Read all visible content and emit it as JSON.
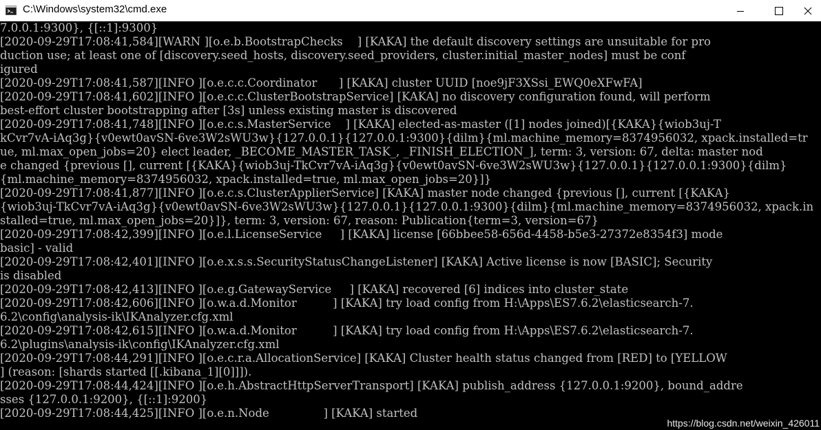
{
  "window": {
    "title": "C:\\Windows\\system32\\cmd.exe",
    "icon": "cmd-icon",
    "buttons": [
      "minimize-icon",
      "maximize-icon",
      "close-icon"
    ]
  },
  "colors": {
    "console_bg": "#000000",
    "console_text": "#c0c0c0",
    "titlebar_bg": "#ffffff"
  },
  "console": {
    "lines": [
      "7.0.0.1:9300}, {[::1]:9300}",
      "[2020-09-29T17:08:41,584][WARN ][o.e.b.BootstrapChecks    ] [KAKA] the default discovery settings are unsuitable for pro",
      "duction use; at least one of [discovery.seed_hosts, discovery.seed_providers, cluster.initial_master_nodes] must be conf",
      "igured",
      "[2020-09-29T17:08:41,587][INFO ][o.e.c.c.Coordinator      ] [KAKA] cluster UUID [noe9jF3XSsi_EWQ0eXFwFA]",
      "[2020-09-29T17:08:41,602][INFO ][o.e.c.c.ClusterBootstrapService] [KAKA] no discovery configuration found, will perform",
      "best-effort cluster bootstrapping after [3s] unless existing master is discovered",
      "[2020-09-29T17:08:41,748][INFO ][o.e.c.s.MasterService    ] [KAKA] elected-as-master ([1] nodes joined)[{KAKA}{wiob3uj-T",
      "kCvr7vA-iAq3g}{v0ewt0avSN-6ve3W2sWU3w}{127.0.0.1}{127.0.0.1:9300}{dilm}{ml.machine_memory=8374956032, xpack.installed=tr",
      "ue, ml.max_open_jobs=20} elect leader, _BECOME_MASTER_TASK_, _FINISH_ELECTION_], term: 3, version: 67, delta: master nod",
      "e changed {previous [], current [{KAKA}{wiob3uj-TkCvr7vA-iAq3g}{v0ewt0avSN-6ve3W2sWU3w}{127.0.0.1}{127.0.0.1:9300}{dilm}",
      "{ml.machine_memory=8374956032, xpack.installed=true, ml.max_open_jobs=20}]}",
      "[2020-09-29T17:08:41,877][INFO ][o.e.c.s.ClusterApplierService] [KAKA] master node changed {previous [], current [{KAKA}",
      "{wiob3uj-TkCvr7vA-iAq3g}{v0ewt0avSN-6ve3W2sWU3w}{127.0.0.1}{127.0.0.1:9300}{dilm}{ml.machine_memory=8374956032, xpack.in",
      "stalled=true, ml.max_open_jobs=20}]}, term: 3, version: 67, reason: Publication{term=3, version=67}",
      "[2020-09-29T17:08:42,399][INFO ][o.e.l.LicenseService     ] [KAKA] license [66bbee58-656d-4458-b5e3-27372e8354f3] mode",
      "basic] - valid",
      "[2020-09-29T17:08:42,401][INFO ][o.e.x.s.s.SecurityStatusChangeListener] [KAKA] Active license is now [BASIC]; Security",
      "is disabled",
      "[2020-09-29T17:08:42,413][INFO ][o.e.g.GatewayService     ] [KAKA] recovered [6] indices into cluster_state",
      "[2020-09-29T17:08:42,606][INFO ][o.w.a.d.Monitor          ] [KAKA] try load config from H:\\Apps\\ES7.6.2\\elasticsearch-7.",
      "6.2\\config\\analysis-ik\\IKAnalyzer.cfg.xml",
      "[2020-09-29T17:08:42,615][INFO ][o.w.a.d.Monitor          ] [KAKA] try load config from H:\\Apps\\ES7.6.2\\elasticsearch-7.",
      "6.2\\plugins\\analysis-ik\\config\\IKAnalyzer.cfg.xml",
      "[2020-09-29T17:08:44,291][INFO ][o.e.c.r.a.AllocationService] [KAKA] Cluster health status changed from [RED] to [YELLOW",
      "] (reason: [shards started [[.kibana_1][0]]]).",
      "[2020-09-29T17:08:44,424][INFO ][o.e.h.AbstractHttpServerTransport] [KAKA] publish_address {127.0.0.1:9200}, bound_addre",
      "sses {127.0.0.1:9200}, {[::1]:9200}",
      "[2020-09-29T17:08:44,425][INFO ][o.e.n.Node               ] [KAKA] started"
    ]
  },
  "watermark": {
    "text": "https://blog.csdn.net/weixin_426011"
  }
}
